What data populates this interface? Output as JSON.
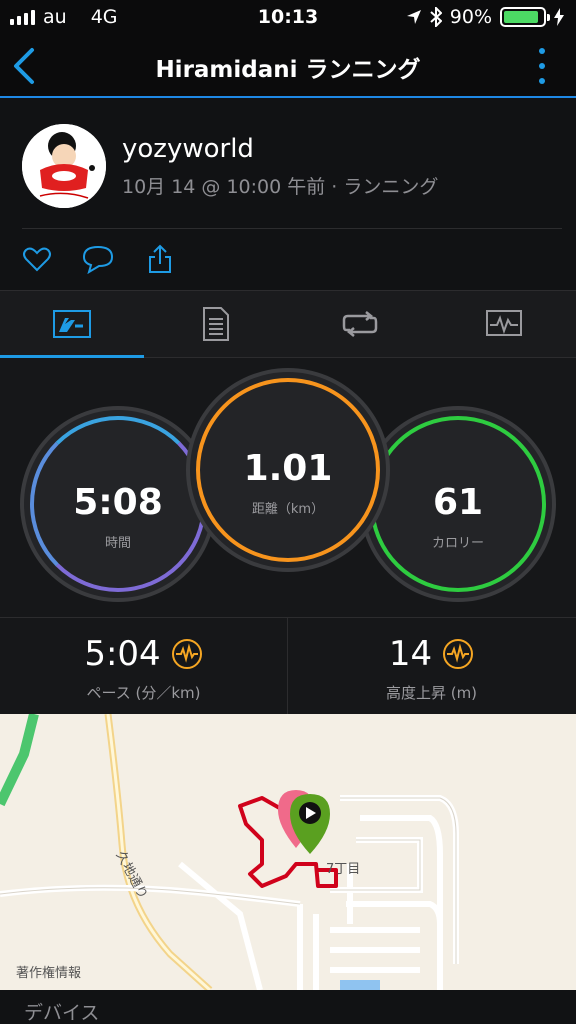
{
  "status_bar": {
    "carrier": "au",
    "network": "4G",
    "time": "10:13",
    "battery": "90%",
    "battery_level": 0.9
  },
  "nav": {
    "title": "Hiramidani ランニング"
  },
  "profile": {
    "username": "yozyworld",
    "subtitle": "10月 14 @ 10:00 午前 · ランニング"
  },
  "rings": {
    "time": {
      "value": "5:08",
      "label": "時間",
      "color": "#7e6bd6"
    },
    "distance": {
      "value": "1.01",
      "label": "距離（km）",
      "color": "#f7941d"
    },
    "calories": {
      "value": "61",
      "label": "カロリー",
      "color": "#2ecc40"
    }
  },
  "stats": {
    "pace": {
      "value": "5:04",
      "label": "ペース (分／km)"
    },
    "elevation": {
      "value": "14",
      "label": "高度上昇 (m)"
    }
  },
  "map": {
    "credit": "著作権情報",
    "road_label": "久地通り",
    "area_label": "7丁目"
  },
  "devices": {
    "label": "デバイス"
  },
  "colors": {
    "accent": "#1e9be5",
    "route": "#d0021b",
    "pulse_icon": "#f5a623"
  }
}
